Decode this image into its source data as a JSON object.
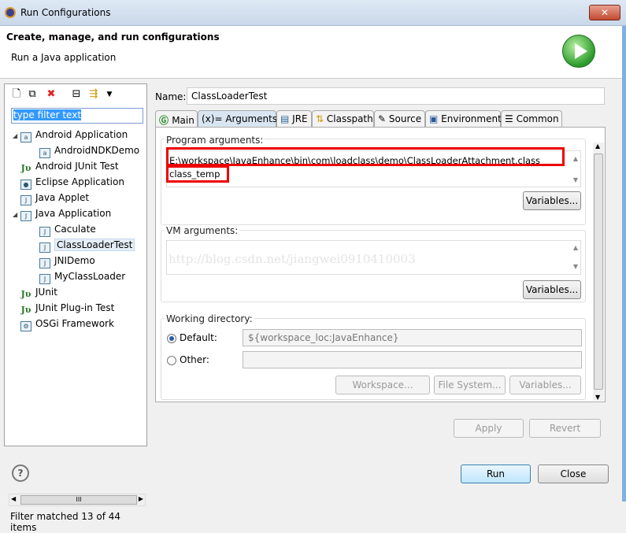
{
  "window": {
    "title": "Run Configurations",
    "close": "✕"
  },
  "header": {
    "title": "Create, manage, and run configurations",
    "subtitle": "Run a Java application"
  },
  "left": {
    "filter_text": "type filter text",
    "tree": [
      {
        "label": "Android Application",
        "level": 0,
        "expanded": true,
        "icon": "android-app-icon"
      },
      {
        "label": "AndroidNDKDemo",
        "level": 1,
        "icon": "android-app-icon"
      },
      {
        "label": "Android JUnit Test",
        "level": 0,
        "icon": "junit-icon"
      },
      {
        "label": "Eclipse Application",
        "level": 0,
        "icon": "eclipse-icon"
      },
      {
        "label": "Java Applet",
        "level": 0,
        "icon": "applet-icon"
      },
      {
        "label": "Java Application",
        "level": 0,
        "expanded": true,
        "icon": "java-app-icon"
      },
      {
        "label": "Caculate",
        "level": 1,
        "icon": "java-app-icon"
      },
      {
        "label": "ClassLoaderTest",
        "level": 1,
        "icon": "java-app-icon",
        "selected": true
      },
      {
        "label": "JNIDemo",
        "level": 1,
        "icon": "java-app-icon"
      },
      {
        "label": "MyClassLoader",
        "level": 1,
        "icon": "java-app-icon"
      },
      {
        "label": "JUnit",
        "level": 0,
        "icon": "junit-icon"
      },
      {
        "label": "JUnit Plug-in Test",
        "level": 0,
        "icon": "junit-icon"
      },
      {
        "label": "OSGi Framework",
        "level": 0,
        "icon": "osgi-icon"
      }
    ],
    "status": "Filter matched 13 of 44 items"
  },
  "right": {
    "name_label": "Name:",
    "name_value": "ClassLoaderTest",
    "tabs": [
      "Main",
      "(x)= Arguments",
      "JRE",
      "Classpath",
      "Source",
      "Environment",
      "Common"
    ],
    "program_args_label": "Program arguments:",
    "program_args_line1": "E:\\workspace\\JavaEnhance\\bin\\com\\loadclass\\demo\\ClassLoaderAttachment.class",
    "program_args_line2": "class_temp",
    "variables": "Variables...",
    "vm_args_label": "VM arguments:",
    "watermark": "http://blog.csdn.net/jiangwei0910410003",
    "workdir_label": "Working directory:",
    "default_label": "Default:",
    "default_value": "${workspace_loc:JavaEnhance}",
    "other_label": "Other:",
    "workspace_btn": "Workspace...",
    "filesystem_btn": "File System..."
  },
  "footer": {
    "apply": "Apply",
    "revert": "Revert",
    "run": "Run",
    "close": "Close",
    "help": "?"
  }
}
